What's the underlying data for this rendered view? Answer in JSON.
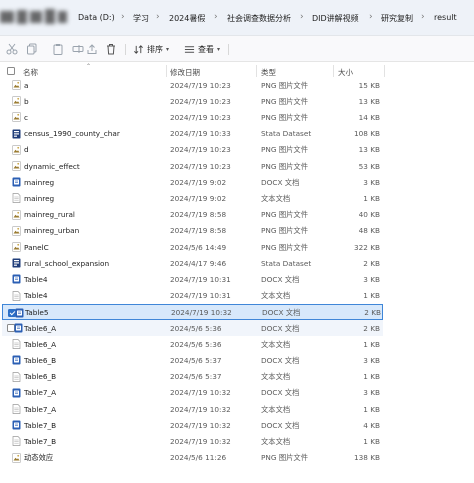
{
  "breadcrumb": {
    "items": [
      "Data (D:)",
      "学习",
      "2024暑假",
      "社会调查数据分析",
      "DID讲解视频",
      "研究复制",
      "result"
    ]
  },
  "toolbar": {
    "sort_label": "排序",
    "view_label": "查看"
  },
  "columns": {
    "name": "名称",
    "date": "修改日期",
    "type": "类型",
    "size": "大小"
  },
  "colors": {
    "accent": "#2b6fc7",
    "selected_bg": "#d7e8fb",
    "png_icon": "#9a7a2e",
    "docx_icon": "#2b5fb4",
    "stata_icon": "#1f3d7a"
  },
  "files": [
    {
      "name": "a",
      "date": "2024/7/19 10:23",
      "type": "PNG 图片文件",
      "size": "15 KB",
      "icon": "png-icon",
      "state": ""
    },
    {
      "name": "b",
      "date": "2024/7/19 10:23",
      "type": "PNG 图片文件",
      "size": "13 KB",
      "icon": "png-icon",
      "state": ""
    },
    {
      "name": "c",
      "date": "2024/7/19 10:23",
      "type": "PNG 图片文件",
      "size": "14 KB",
      "icon": "png-icon",
      "state": ""
    },
    {
      "name": "census_1990_county_char",
      "date": "2024/7/19 10:33",
      "type": "Stata Dataset",
      "size": "108 KB",
      "icon": "stata-icon",
      "state": ""
    },
    {
      "name": "d",
      "date": "2024/7/19 10:23",
      "type": "PNG 图片文件",
      "size": "13 KB",
      "icon": "png-icon",
      "state": ""
    },
    {
      "name": "dynamic_effect",
      "date": "2024/7/19 10:23",
      "type": "PNG 图片文件",
      "size": "53 KB",
      "icon": "png-icon",
      "state": ""
    },
    {
      "name": "mainreg",
      "date": "2024/7/19 9:02",
      "type": "DOCX 文档",
      "size": "3 KB",
      "icon": "docx-icon",
      "state": ""
    },
    {
      "name": "mainreg",
      "date": "2024/7/19 9:02",
      "type": "文本文档",
      "size": "1 KB",
      "icon": "txt-icon",
      "state": ""
    },
    {
      "name": "mainreg_rural",
      "date": "2024/7/19 8:58",
      "type": "PNG 图片文件",
      "size": "40 KB",
      "icon": "png-icon",
      "state": ""
    },
    {
      "name": "mainreg_urban",
      "date": "2024/7/19 8:58",
      "type": "PNG 图片文件",
      "size": "48 KB",
      "icon": "png-icon",
      "state": ""
    },
    {
      "name": "PanelC",
      "date": "2024/5/6 14:49",
      "type": "PNG 图片文件",
      "size": "322 KB",
      "icon": "png-icon",
      "state": ""
    },
    {
      "name": "rural_school_expansion",
      "date": "2024/4/17 9:46",
      "type": "Stata Dataset",
      "size": "2 KB",
      "icon": "stata-icon",
      "state": ""
    },
    {
      "name": "Table4",
      "date": "2024/7/19 10:31",
      "type": "DOCX 文档",
      "size": "3 KB",
      "icon": "docx-icon",
      "state": ""
    },
    {
      "name": "Table4",
      "date": "2024/7/19 10:31",
      "type": "文本文档",
      "size": "1 KB",
      "icon": "txt-icon",
      "state": ""
    },
    {
      "name": "Table5",
      "date": "2024/7/19 10:32",
      "type": "DOCX 文档",
      "size": "2 KB",
      "icon": "docx-icon",
      "state": "selected"
    },
    {
      "name": "Table6_A",
      "date": "2024/5/6 5:36",
      "type": "DOCX 文档",
      "size": "2 KB",
      "icon": "docx-icon",
      "state": "hover"
    },
    {
      "name": "Table6_A",
      "date": "2024/5/6 5:36",
      "type": "文本文档",
      "size": "1 KB",
      "icon": "txt-icon",
      "state": ""
    },
    {
      "name": "Table6_B",
      "date": "2024/5/6 5:37",
      "type": "DOCX 文档",
      "size": "3 KB",
      "icon": "docx-icon",
      "state": ""
    },
    {
      "name": "Table6_B",
      "date": "2024/5/6 5:37",
      "type": "文本文档",
      "size": "1 KB",
      "icon": "txt-icon",
      "state": ""
    },
    {
      "name": "Table7_A",
      "date": "2024/7/19 10:32",
      "type": "DOCX 文档",
      "size": "3 KB",
      "icon": "docx-icon",
      "state": ""
    },
    {
      "name": "Table7_A",
      "date": "2024/7/19 10:32",
      "type": "文本文档",
      "size": "1 KB",
      "icon": "txt-icon",
      "state": ""
    },
    {
      "name": "Table7_B",
      "date": "2024/7/19 10:32",
      "type": "DOCX 文档",
      "size": "4 KB",
      "icon": "docx-icon",
      "state": ""
    },
    {
      "name": "Table7_B",
      "date": "2024/7/19 10:32",
      "type": "文本文档",
      "size": "1 KB",
      "icon": "txt-icon",
      "state": ""
    },
    {
      "name": "动态效应",
      "date": "2024/5/6 11:26",
      "type": "PNG 图片文件",
      "size": "138 KB",
      "icon": "png-icon",
      "state": ""
    }
  ]
}
